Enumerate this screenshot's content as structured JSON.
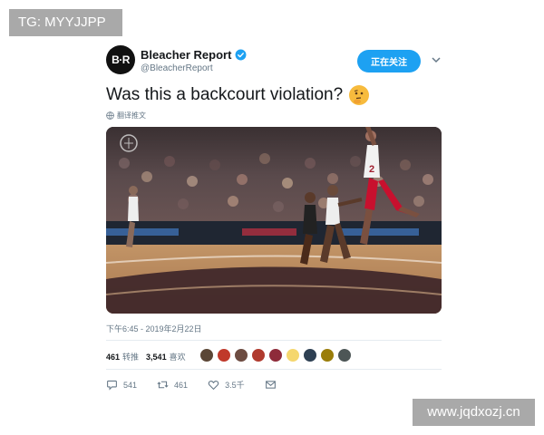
{
  "watermarks": {
    "top": "TG: MYYJJPP",
    "bottom": "www.jqdxozj.cn"
  },
  "tweet": {
    "avatar_text": "B·R",
    "author_name": "Bleacher Report",
    "handle": "@BleacherReport",
    "follow_label": "正在关注",
    "text": "Was this a backcourt violation?",
    "translate_label": "翻译推文",
    "timestamp": "下午6:45 - 2019年2月22日",
    "jersey_number": "2"
  },
  "stats": {
    "retweets_count": "461",
    "retweets_label": "转推",
    "likes_count": "3,541",
    "likes_label": "喜欢"
  },
  "actions": {
    "reply_count": "541",
    "retweet_count": "461",
    "like_count": "3.5千"
  },
  "colors": {
    "accent": "#1da1f2",
    "secondary_text": "#657786",
    "court_wood": "#c89a6a"
  },
  "icons": {
    "verified": "verified-badge-icon",
    "caret": "chevron-down-icon",
    "reply": "reply-icon",
    "retweet": "retweet-icon",
    "like": "heart-icon",
    "dm": "envelope-icon",
    "translate": "globe-icon",
    "emoji": "thinking-face-emoji"
  }
}
